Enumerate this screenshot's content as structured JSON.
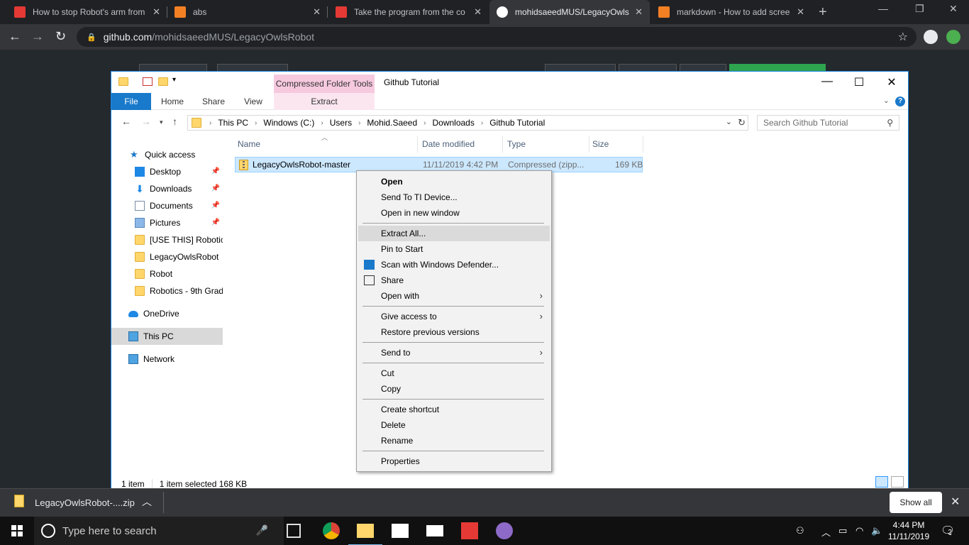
{
  "browser": {
    "tabs": [
      {
        "title": "How to stop Robot's arm from",
        "favicon_color": "#e53935"
      },
      {
        "title": "abs",
        "favicon_color": "#f48024"
      },
      {
        "title": "Take the program from the co",
        "favicon_color": "#e53935"
      },
      {
        "title": "mohidsaeedMUS/LegacyOwlsR",
        "favicon_color": "#ffffff"
      },
      {
        "title": "markdown - How to add scree",
        "favicon_color": "#f48024"
      }
    ],
    "url_host": "github.com",
    "url_path": "/mohidsaeedMUS/LegacyOwlsRobot"
  },
  "explorer": {
    "context_tab": "Compressed Folder Tools",
    "window_title": "Github Tutorial",
    "ribbon_tabs": [
      "File",
      "Home",
      "Share",
      "View",
      "Extract"
    ],
    "breadcrumbs": [
      "This PC",
      "Windows (C:)",
      "Users",
      "Mohid.Saeed",
      "Downloads",
      "Github Tutorial"
    ],
    "search_placeholder": "Search Github Tutorial",
    "nav": {
      "quick_access": "Quick access",
      "items": [
        "Desktop",
        "Downloads",
        "Documents",
        "Pictures",
        "[USE THIS] Robotics",
        "LegacyOwlsRobot",
        "Robot",
        "Robotics - 9th Grad"
      ],
      "onedrive": "OneDrive",
      "thispc": "This PC",
      "network": "Network"
    },
    "columns": [
      "Name",
      "Date modified",
      "Type",
      "Size"
    ],
    "file": {
      "name": "LegacyOwlsRobot-master",
      "date": "11/11/2019 4:42 PM",
      "type": "Compressed (zipp...",
      "size": "169 KB"
    },
    "status": {
      "count": "1 item",
      "selected": "1 item selected  168 KB"
    }
  },
  "context_menu": {
    "open": "Open",
    "send_ti": "Send To TI Device...",
    "open_new": "Open in new window",
    "extract_all": "Extract All...",
    "pin_start": "Pin to Start",
    "scan": "Scan with Windows Defender...",
    "share": "Share",
    "open_with": "Open with",
    "give_access": "Give access to",
    "restore": "Restore previous versions",
    "send_to": "Send to",
    "cut": "Cut",
    "copy": "Copy",
    "create_shortcut": "Create shortcut",
    "delete": "Delete",
    "rename": "Rename",
    "properties": "Properties"
  },
  "download_bar": {
    "file": "LegacyOwlsRobot-....zip",
    "show_all": "Show all"
  },
  "taskbar": {
    "search_placeholder": "Type here to search",
    "time": "4:44 PM",
    "date": "11/11/2019",
    "notifications": "2"
  }
}
